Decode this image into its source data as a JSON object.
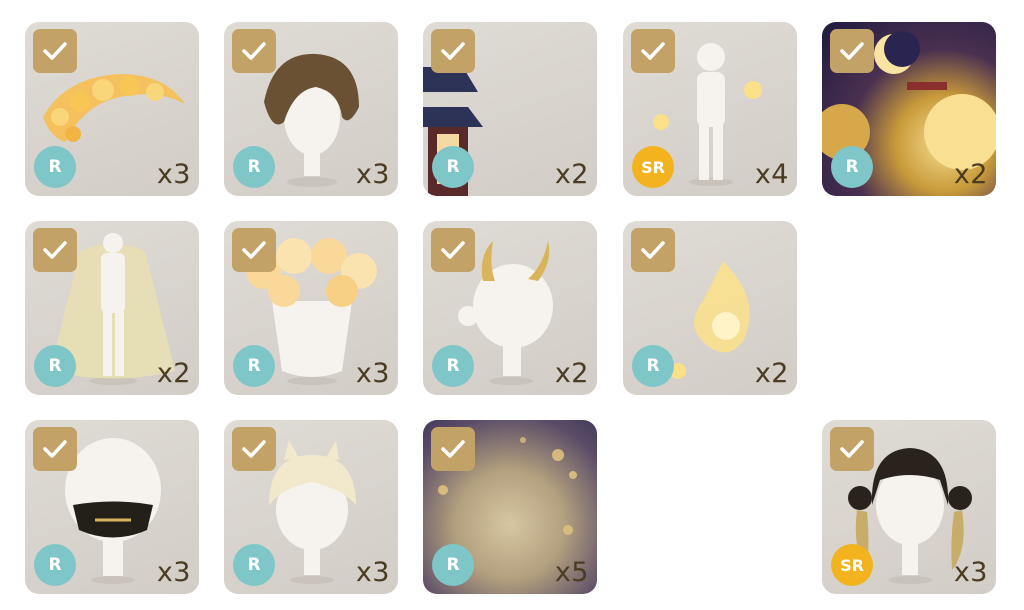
{
  "items": [
    {
      "label": "golden-flower-wreath",
      "rarity": "R",
      "qty": "x3",
      "checked": true
    },
    {
      "label": "brown-wavy-hair",
      "rarity": "R",
      "qty": "x3",
      "checked": true
    },
    {
      "label": "pagoda-lantern",
      "rarity": "R",
      "qty": "x2",
      "checked": true
    },
    {
      "label": "spirit-flames-outfit",
      "rarity": "SR",
      "qty": "x4",
      "checked": true
    },
    {
      "label": "moonlit-shrine-background",
      "rarity": "R",
      "qty": "x2",
      "checked": true
    },
    {
      "label": "golden-lace-robe",
      "rarity": "R",
      "qty": "x2",
      "checked": true
    },
    {
      "label": "flower-cloud-top",
      "rarity": "R",
      "qty": "x3",
      "checked": true
    },
    {
      "label": "golden-horns",
      "rarity": "R",
      "qty": "x2",
      "checked": true
    },
    {
      "label": "glowing-flower-flame",
      "rarity": "R",
      "qty": "x2",
      "checked": true
    },
    {
      "label": "black-gold-mask",
      "rarity": "R",
      "qty": "x3",
      "checked": true
    },
    {
      "label": "blonde-cat-ear-hair",
      "rarity": "R",
      "qty": "x3",
      "checked": true
    },
    {
      "label": "sparkle-floor-background",
      "rarity": "R",
      "qty": "x5",
      "checked": true
    },
    {
      "label": "black-gold-twin-hair",
      "rarity": "SR",
      "qty": "x3",
      "checked": true
    }
  ],
  "colors": {
    "check_bg": "#c2a266",
    "rarity_r": "#7fc6c8",
    "rarity_sr": "#f2b31f",
    "qty_text": "#4a3b22",
    "card_bg": "#d8d4ce"
  }
}
